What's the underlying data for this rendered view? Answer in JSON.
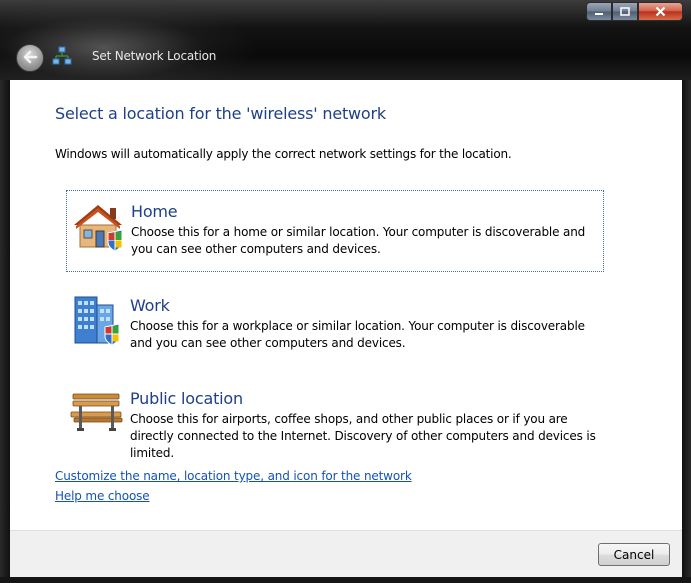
{
  "window": {
    "title": "Set Network Location",
    "colors": {
      "heading": "#1e3f8a",
      "link": "#1452b8",
      "frame": "#121212",
      "close": "#c4432a"
    }
  },
  "titlebar": {
    "back_icon": "back-arrow-icon",
    "app_icon": "network-icon",
    "minimize_icon": "minimize-icon",
    "maximize_icon": "maximize-icon",
    "close_icon": "close-icon"
  },
  "main": {
    "heading": "Select a location for the 'wireless' network",
    "subtext": "Windows will automatically apply the correct network settings for the location.",
    "options": [
      {
        "title": "Home",
        "description": "Choose this for a home or similar location. Your computer is discoverable and you can see other computers and devices.",
        "icon": "home-icon"
      },
      {
        "title": "Work",
        "description": "Choose this for a workplace or similar location. Your computer is discoverable and you can see other computers and devices.",
        "icon": "office-building-icon"
      },
      {
        "title": "Public location",
        "description": "Choose this for airports, coffee shops, and other public places or if you are directly connected to the Internet. Discovery of other computers and devices is limited.",
        "icon": "park-bench-icon"
      }
    ],
    "links": {
      "customize": "Customize the name, location type, and icon for the network",
      "help": "Help me choose"
    }
  },
  "footer": {
    "cancel_label": "Cancel"
  }
}
